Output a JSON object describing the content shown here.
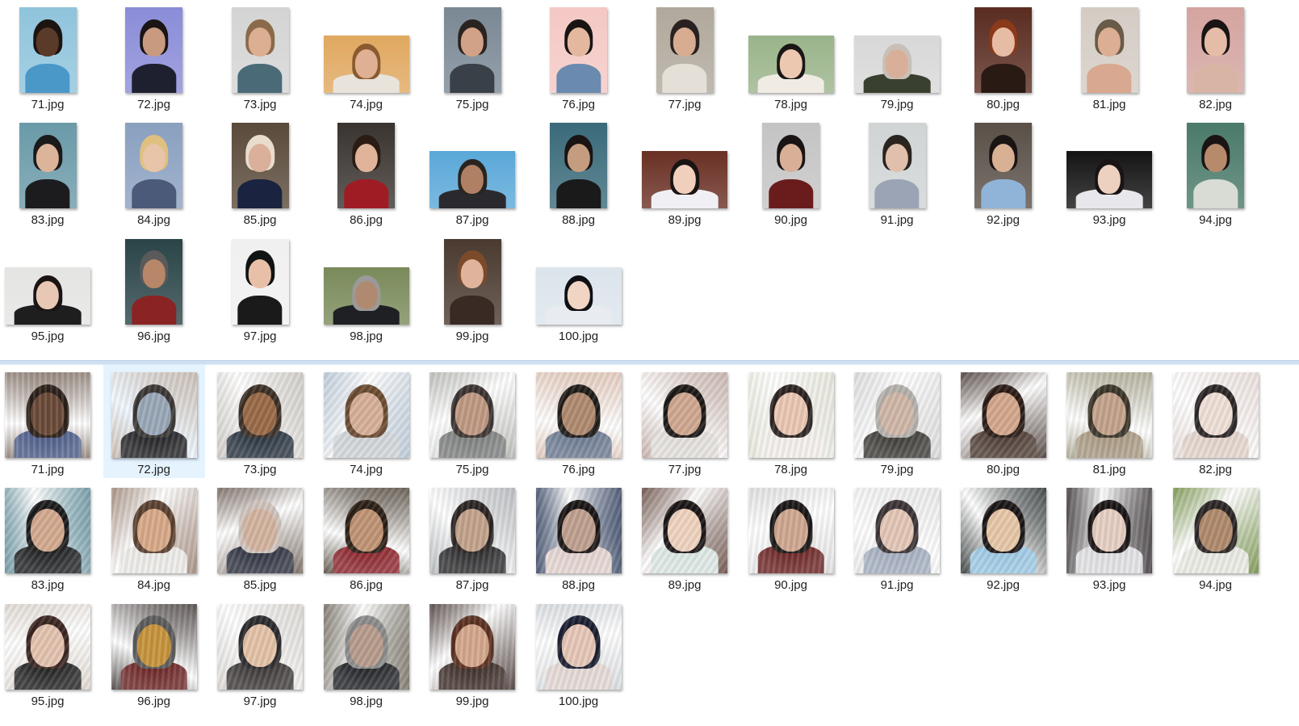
{
  "originals": [
    {
      "name": "71.jpg",
      "orientation": "portrait",
      "bg": "#8fc4dc",
      "skin": "#5a3a28",
      "hair": "#1c1410",
      "cloth": "#4a98c8"
    },
    {
      "name": "72.jpg",
      "orientation": "portrait",
      "bg": "#8a8cd8",
      "skin": "#c89a80",
      "hair": "#1a1414",
      "cloth": "#1e2030"
    },
    {
      "name": "73.jpg",
      "orientation": "portrait",
      "bg": "#d4d4d4",
      "skin": "#dcae92",
      "hair": "#8a6a4a",
      "cloth": "#4a6a78"
    },
    {
      "name": "74.jpg",
      "orientation": "landscape",
      "bg": "#e0a860",
      "skin": "#e0b094",
      "hair": "#8a5a30",
      "cloth": "#e8e4dc"
    },
    {
      "name": "75.jpg",
      "orientation": "portrait",
      "bg": "#7a8894",
      "skin": "#d2a288",
      "hair": "#2a2420",
      "cloth": "#3a4048"
    },
    {
      "name": "76.jpg",
      "orientation": "portrait",
      "bg": "#f4c8c4",
      "skin": "#e4b89e",
      "hair": "#181414",
      "cloth": "#6a8ab0"
    },
    {
      "name": "77.jpg",
      "orientation": "portrait",
      "bg": "#b0a89c",
      "skin": "#d8ac90",
      "hair": "#2a2220",
      "cloth": "#e4e0d8"
    },
    {
      "name": "78.jpg",
      "orientation": "landscape",
      "bg": "#9ab48a",
      "skin": "#ecc8b0",
      "hair": "#1a1616",
      "cloth": "#f0ece4"
    },
    {
      "name": "79.jpg",
      "orientation": "landscape",
      "bg": "#d8d8d8",
      "skin": "#d8b09a",
      "hair": "#c8c0b8",
      "cloth": "#3a4030"
    },
    {
      "name": "80.jpg",
      "orientation": "portrait",
      "bg": "#5a2c20",
      "skin": "#e6bca4",
      "hair": "#8a3a1a",
      "cloth": "#2a1a14"
    },
    {
      "name": "81.jpg",
      "orientation": "portrait",
      "bg": "#d4ccc4",
      "skin": "#dcae94",
      "hair": "#6a5a48",
      "cloth": "#d8a890"
    },
    {
      "name": "82.jpg",
      "orientation": "portrait",
      "bg": "#d4a4a0",
      "skin": "#e4bca8",
      "hair": "#1a1414",
      "cloth": "#d8b4a4"
    },
    {
      "name": "83.jpg",
      "orientation": "portrait",
      "bg": "#6a9aa8",
      "skin": "#dcb49a",
      "hair": "#1a1a1a",
      "cloth": "#1c1c1e"
    },
    {
      "name": "84.jpg",
      "orientation": "portrait",
      "bg": "#8aa0c0",
      "skin": "#e8c4a8",
      "hair": "#e0c080",
      "cloth": "#4a5a78"
    },
    {
      "name": "85.jpg",
      "orientation": "portrait",
      "bg": "#5a4a3a",
      "skin": "#dab09a",
      "hair": "#e8dccc",
      "cloth": "#1a2440"
    },
    {
      "name": "86.jpg",
      "orientation": "portrait",
      "bg": "#3a3430",
      "skin": "#e0b49a",
      "hair": "#2a1c14",
      "cloth": "#a01c24"
    },
    {
      "name": "87.jpg",
      "orientation": "landscape",
      "bg": "#5aa8d8",
      "skin": "#b08064",
      "hair": "#2a2420",
      "cloth": "#2a2a2e"
    },
    {
      "name": "88.jpg",
      "orientation": "portrait",
      "bg": "#3a6a7a",
      "skin": "#c49c80",
      "hair": "#1a1414",
      "cloth": "#1a1a1a"
    },
    {
      "name": "89.jpg",
      "orientation": "landscape",
      "bg": "#6a3024",
      "skin": "#f0d0bc",
      "hair": "#1a1414",
      "cloth": "#f0f0f4"
    },
    {
      "name": "90.jpg",
      "orientation": "portrait",
      "bg": "#c4c4c4",
      "skin": "#d8b098",
      "hair": "#1a1414",
      "cloth": "#6a1c1c"
    },
    {
      "name": "91.jpg",
      "orientation": "portrait",
      "bg": "#d0d4d4",
      "skin": "#e0c0ac",
      "hair": "#2a2420",
      "cloth": "#9aa4b4"
    },
    {
      "name": "92.jpg",
      "orientation": "portrait",
      "bg": "#5a5048",
      "skin": "#d8b094",
      "hair": "#1a1414",
      "cloth": "#90b4d8"
    },
    {
      "name": "93.jpg",
      "orientation": "landscape",
      "bg": "#141414",
      "skin": "#ecd0c0",
      "hair": "#1a1414",
      "cloth": "#e8e8ec"
    },
    {
      "name": "94.jpg",
      "orientation": "portrait",
      "bg": "#4a7a6a",
      "skin": "#b88a6c",
      "hair": "#1a1414",
      "cloth": "#d8dcd4"
    },
    {
      "name": "95.jpg",
      "orientation": "landscape",
      "bg": "#e4e4e2",
      "skin": "#e8c8b4",
      "hair": "#1a1414",
      "cloth": "#1e1e1e"
    },
    {
      "name": "96.jpg",
      "orientation": "portrait",
      "bg": "#2a4448",
      "skin": "#b88668",
      "hair": "#5a5a5a",
      "cloth": "#8a2424"
    },
    {
      "name": "97.jpg",
      "orientation": "portrait",
      "bg": "#f0f0f0",
      "skin": "#e8c0a8",
      "hair": "#101414",
      "cloth": "#1a1a1a"
    },
    {
      "name": "98.jpg",
      "orientation": "landscape",
      "bg": "#7a8a5a",
      "skin": "#b08a70",
      "hair": "#9a9a9a",
      "cloth": "#1e2024"
    },
    {
      "name": "99.jpg",
      "orientation": "portrait",
      "bg": "#4a3a30",
      "skin": "#e0b49c",
      "hair": "#7a4a2a",
      "cloth": "#3a2a24"
    },
    {
      "name": "100.jpg",
      "orientation": "landscape",
      "bg": "#dce4ec",
      "skin": "#f0d4c4",
      "hair": "#101014",
      "cloth": "#e8ecf0"
    }
  ],
  "generated": [
    {
      "name": "71.jpg",
      "bg": "#8a7a70",
      "skin": "#6a4a38",
      "hair": "#2a2018",
      "cloth": "#4a5a88"
    },
    {
      "name": "72.jpg",
      "bg": "#c4b4a8",
      "skin": "#9aa8b8",
      "hair": "#3a3634",
      "cloth": "#1e1e22",
      "selected": true
    },
    {
      "name": "73.jpg",
      "bg": "#cac6c0",
      "skin": "#9a6a48",
      "hair": "#3a2e24",
      "cloth": "#24303c"
    },
    {
      "name": "74.jpg",
      "bg": "#b4c4d4",
      "skin": "#d8b09a",
      "hair": "#6a4a30",
      "cloth": "#d0d4d8"
    },
    {
      "name": "75.jpg",
      "bg": "#b4b4b0",
      "skin": "#c09a84",
      "hair": "#3a3230",
      "cloth": "#7a7e7c"
    },
    {
      "name": "76.jpg",
      "bg": "#e0c4b4",
      "skin": "#b08a70",
      "hair": "#1e1a18",
      "cloth": "#6a7890"
    },
    {
      "name": "77.jpg",
      "bg": "#c0a8a0",
      "skin": "#d0a890",
      "hair": "#1a1614",
      "cloth": "#e4e0dc"
    },
    {
      "name": "78.jpg",
      "bg": "#e4e4d8",
      "skin": "#ecc8b4",
      "hair": "#2a2220",
      "cloth": "#f4f0ec"
    },
    {
      "name": "79.jpg",
      "bg": "#d8d8d8",
      "skin": "#d0b8a8",
      "hair": "#b4b0ac",
      "cloth": "#3a3834"
    },
    {
      "name": "80.jpg",
      "bg": "#3a2a24",
      "skin": "#d4a88c",
      "hair": "#2a1a14",
      "cloth": "#4a3830"
    },
    {
      "name": "81.jpg",
      "bg": "#a8a48c",
      "skin": "#c4a48c",
      "hair": "#3a3428",
      "cloth": "#a89880"
    },
    {
      "name": "82.jpg",
      "bg": "#e8dcd8",
      "skin": "#f0e0d8",
      "hair": "#2a2424",
      "cloth": "#e4d4cc"
    },
    {
      "name": "83.jpg",
      "bg": "#5a8a98",
      "skin": "#d4aa90",
      "hair": "#1a1a1a",
      "cloth": "#1a1c1e"
    },
    {
      "name": "84.jpg",
      "bg": "#9a8070",
      "skin": "#d8aa88",
      "hair": "#5a4030",
      "cloth": "#ecebe8"
    },
    {
      "name": "85.jpg",
      "bg": "#6a5a50",
      "skin": "#d4b4a0",
      "hair": "#cfc4bc",
      "cloth": "#2a2e3c"
    },
    {
      "name": "86.jpg",
      "bg": "#4a4034",
      "skin": "#c09474",
      "hair": "#2a1e14",
      "cloth": "#8a2028"
    },
    {
      "name": "87.jpg",
      "bg": "#b0b4b8",
      "skin": "#c4a48c",
      "hair": "#2a2422",
      "cloth": "#2a2a2c"
    },
    {
      "name": "88.jpg",
      "bg": "#2a3a5a",
      "skin": "#c0a090",
      "hair": "#1a1414",
      "cloth": "#e4d4d0"
    },
    {
      "name": "89.jpg",
      "bg": "#5a3a30",
      "skin": "#f0d4c0",
      "hair": "#1a1414",
      "cloth": "#dce8e4"
    },
    {
      "name": "90.jpg",
      "bg": "#dcdcdc",
      "skin": "#d0a890",
      "hair": "#1a1616",
      "cloth": "#6a2020"
    },
    {
      "name": "91.jpg",
      "bg": "#e8e8ea",
      "skin": "#e4c8b8",
      "hair": "#3a3234",
      "cloth": "#a4aec0"
    },
    {
      "name": "92.jpg",
      "bg": "#1e2424",
      "skin": "#e8c8a8",
      "hair": "#1a1414",
      "cloth": "#9ac8e4"
    },
    {
      "name": "93.jpg",
      "bg": "#2a2428",
      "skin": "#e8d0c4",
      "hair": "#1a1414",
      "cloth": "#e0e0e4"
    },
    {
      "name": "94.jpg",
      "bg": "#6a8a3a",
      "skin": "#b08a6c",
      "hair": "#2a2424",
      "cloth": "#eaeae4"
    },
    {
      "name": "95.jpg",
      "bg": "#dcd4cc",
      "skin": "#e4c4b0",
      "hair": "#3a2420",
      "cloth": "#1e1e1e"
    },
    {
      "name": "96.jpg",
      "bg": "#3a3230",
      "skin": "#c8943c",
      "hair": "#5a5a5a",
      "cloth": "#6a2020"
    },
    {
      "name": "97.jpg",
      "bg": "#d8d4d0",
      "skin": "#e4c4a8",
      "hair": "#2a2a2c",
      "cloth": "#3a3434"
    },
    {
      "name": "98.jpg",
      "bg": "#6a6458",
      "skin": "#b89c8c",
      "hair": "#8a8a8a",
      "cloth": "#1e2024"
    },
    {
      "name": "99.jpg",
      "bg": "#3a2a26",
      "skin": "#d4a88c",
      "hair": "#5a3020",
      "cloth": "#3a2a24"
    },
    {
      "name": "100.jpg",
      "bg": "#d4d8dc",
      "skin": "#e8c8b8",
      "hair": "#1a1e30",
      "cloth": "#e4d8d4"
    }
  ]
}
